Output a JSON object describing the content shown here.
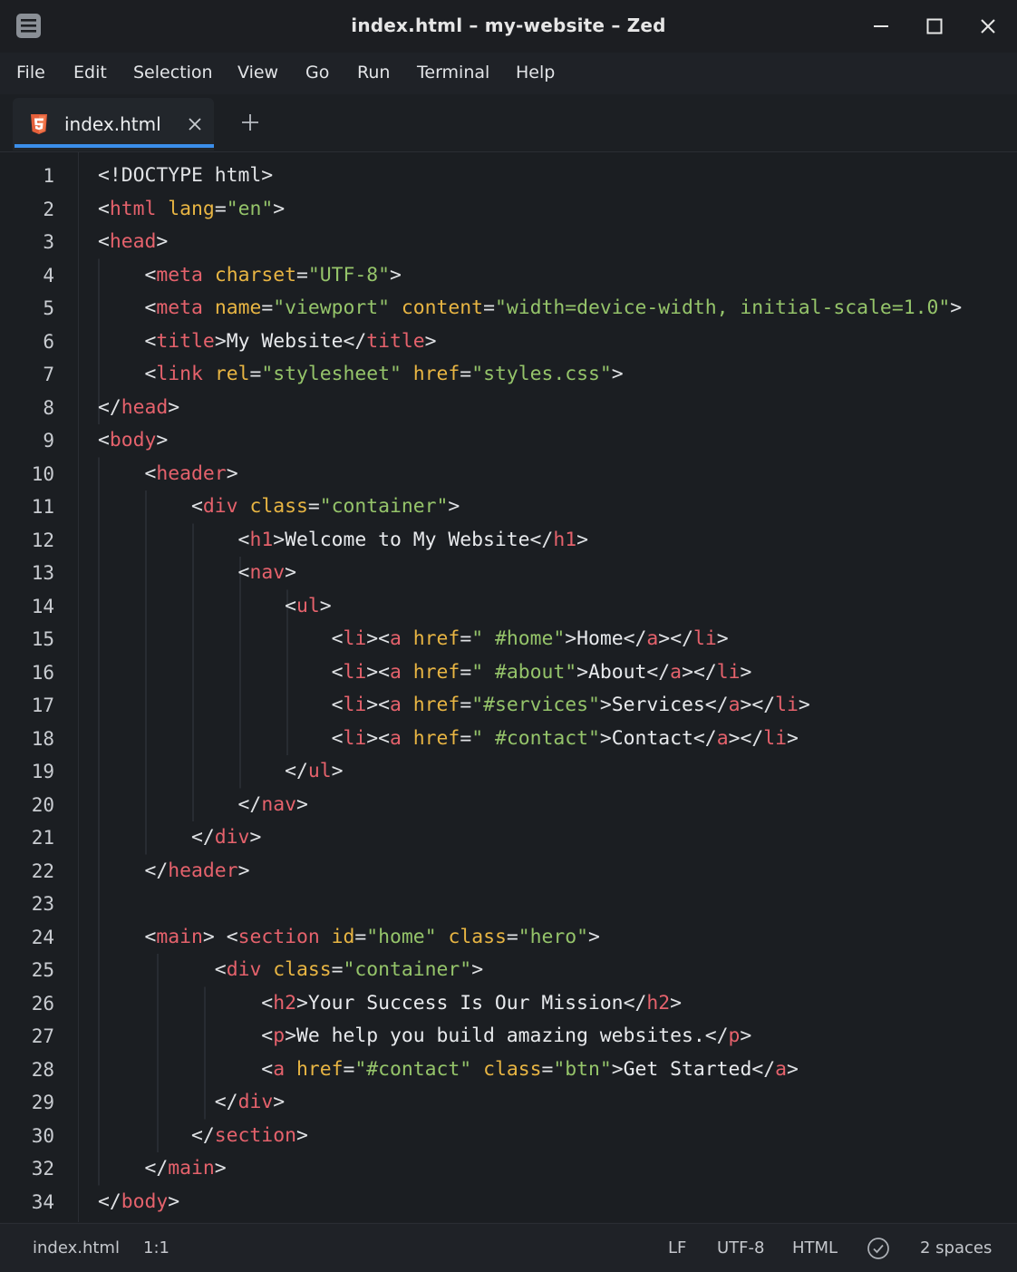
{
  "window": {
    "title": "index.html – my-website – Zed",
    "icons": {
      "app": "editor-app-icon",
      "minimize": "minimize-icon",
      "maximize": "maximize-icon",
      "close": "close-icon"
    }
  },
  "menu": {
    "items": [
      "File",
      "Edit",
      "Selection",
      "View",
      "Go",
      "Run",
      "Terminal",
      "Help"
    ]
  },
  "tabs": {
    "active": {
      "label": "index.html",
      "icon": "html5-file-icon"
    },
    "close_icon": "tab-close-icon",
    "new_tab_icon": "plus-icon"
  },
  "editor": {
    "lines": [
      {
        "n": "1",
        "code": "<!DOCTYPE html>"
      },
      {
        "n": "2",
        "code": "<html lang=\"en\">"
      },
      {
        "n": "3",
        "code": "<head>"
      },
      {
        "n": "4",
        "code": "    <meta charset=\"UTF-8\">"
      },
      {
        "n": "5",
        "code": "    <meta name=\"viewport\" content=\"width=device-width, initial-scale=1.0\">"
      },
      {
        "n": "6",
        "code": "    <title>My Website</title>"
      },
      {
        "n": "7",
        "code": "    <link rel=\"stylesheet\" href=\"styles.css\">"
      },
      {
        "n": "8",
        "code": "</head>"
      },
      {
        "n": "9",
        "code": "<body>"
      },
      {
        "n": "10",
        "code": "    <header>"
      },
      {
        "n": "11",
        "code": "        <div class=\"container\">"
      },
      {
        "n": "12",
        "code": "            <h1>Welcome to My Website</h1>"
      },
      {
        "n": "13",
        "code": "            <nav>"
      },
      {
        "n": "14",
        "code": "                <ul>"
      },
      {
        "n": "15",
        "code": "                    <li><a href=\" #home\">Home</a></li>"
      },
      {
        "n": "16",
        "code": "                    <li><a href=\" #about\">About</a></li>"
      },
      {
        "n": "17",
        "code": "                    <li><a href=\"#services\">Services</a></li>"
      },
      {
        "n": "18",
        "code": "                    <li><a href=\" #contact\">Contact</a></li>"
      },
      {
        "n": "19",
        "code": "                </ul>"
      },
      {
        "n": "20",
        "code": "            </nav>"
      },
      {
        "n": "21",
        "code": "        </div>"
      },
      {
        "n": "22",
        "code": "    </header>"
      },
      {
        "n": "23",
        "code": ""
      },
      {
        "n": "24",
        "code": "    <main> <section id=\"home\" class=\"hero\">"
      },
      {
        "n": "25",
        "code": "          <div class=\"container\">"
      },
      {
        "n": "26",
        "code": "              <h2>Your Success Is Our Mission</h2>"
      },
      {
        "n": "27",
        "code": "              <p>We help you build amazing websites.</p>"
      },
      {
        "n": "28",
        "code": "              <a href=\"#contact\" class=\"btn\">Get Started</a>"
      },
      {
        "n": "29",
        "code": "          </div>"
      },
      {
        "n": "30",
        "code": "        </section>"
      },
      {
        "n": "32",
        "code": "    </main>"
      },
      {
        "n": "34",
        "code": "</body>"
      }
    ]
  },
  "status": {
    "file": "index.html",
    "cursor": "1:1",
    "line_ending": "LF",
    "encoding": "UTF-8",
    "language": "HTML",
    "diagnostics_icon": "check-circle-icon",
    "indent": "2 spaces"
  },
  "colors": {
    "tag": "#e5626c",
    "attribute": "#e8b543",
    "string": "#95c46a",
    "accent": "#3b8eea"
  }
}
